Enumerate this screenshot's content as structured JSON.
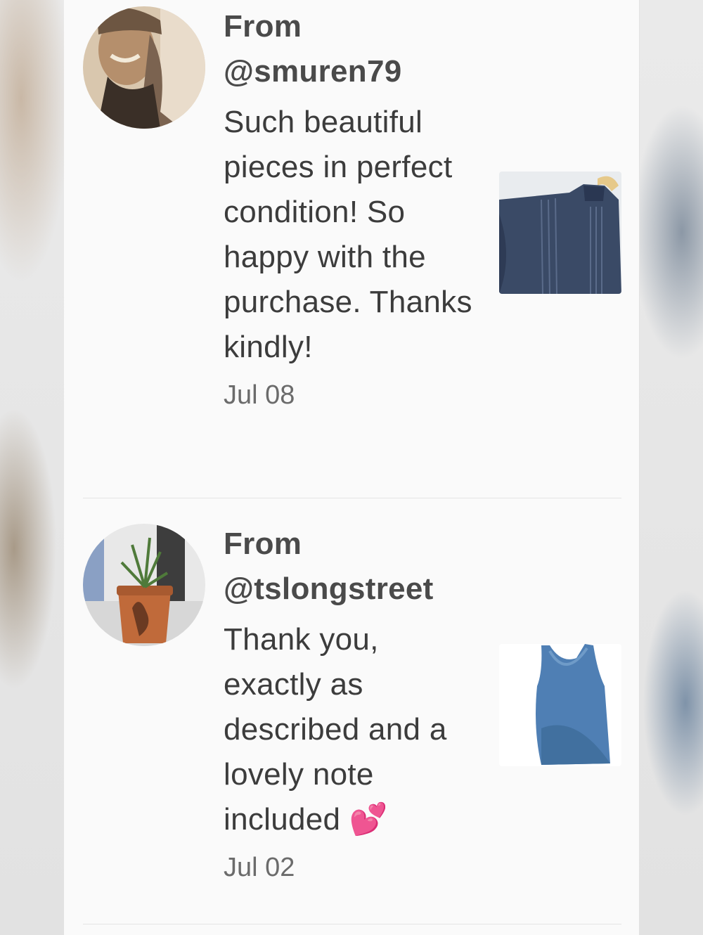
{
  "reviews": [
    {
      "from_label": "From",
      "username": "@smuren79",
      "message": "Such beautiful pieces in perfect condition! So happy with the purchase. Thanks kindly!",
      "date": "Jul 08",
      "avatar_icon": "user-avatar-photo",
      "thumbnail_icon": "navy-lace-blouse-photo"
    },
    {
      "from_label": "From",
      "username": "@tslongstreet",
      "message": "Thank you, exactly as described and a lovely note included 💕",
      "date": "Jul 02",
      "avatar_icon": "potted-plant-photo",
      "thumbnail_icon": "denim-tank-top-photo"
    }
  ],
  "colors": {
    "panel_background": "#fafafa",
    "text_primary": "#3c3c3c",
    "text_secondary": "#6b6b6b",
    "divider": "#e4e4e4"
  }
}
